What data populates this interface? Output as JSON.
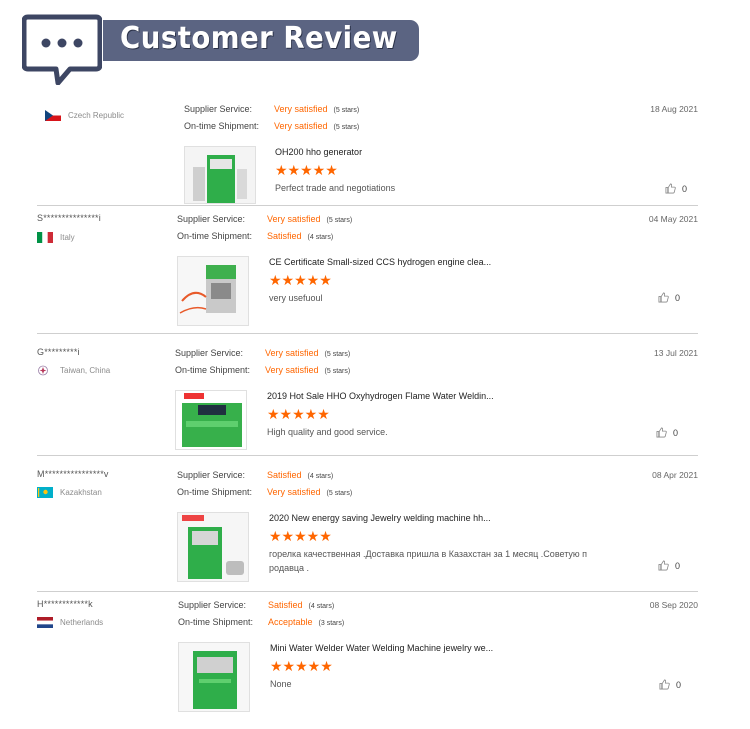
{
  "header": {
    "title": "Customer Review",
    "accent": "#5b6482"
  },
  "labels": {
    "supplier_service": "Supplier Service:",
    "ontime_shipment": "On-time Shipment:"
  },
  "reviews": [
    {
      "buyer": "",
      "country": "Czech Republic",
      "flag_icon": "czech-flag-icon",
      "date": "18 Aug 2021",
      "supplier_service": "Very satisfied",
      "supplier_stars": "(5 stars)",
      "shipment": "Very satisfied",
      "shipment_stars": "(5 stars)",
      "product": "OH200 hho generator",
      "rating": "★★★★★",
      "comment": "Perfect trade and negotiations",
      "likes": "0"
    },
    {
      "buyer": "S***************i",
      "country": "Italy",
      "flag_icon": "italy-flag-icon",
      "date": "04 May 2021",
      "supplier_service": "Very satisfied",
      "supplier_stars": "(5 stars)",
      "shipment": "Satisfied",
      "shipment_stars": "(4 stars)",
      "product": "CE Certificate Small-sized CCS hydrogen engine clea...",
      "rating": "★★★★★",
      "comment": "very usefuoul",
      "likes": "0"
    },
    {
      "buyer": "G*********i",
      "country": "Taiwan, China",
      "flag_icon": "taiwan-flag-icon",
      "date": "13 Jul 2021",
      "supplier_service": "Very satisfied",
      "supplier_stars": "(5 stars)",
      "shipment": "Very satisfied",
      "shipment_stars": "(5 stars)",
      "product": "2019 Hot Sale HHO Oxyhydrogen Flame Water Weldin...",
      "rating": "★★★★★",
      "comment": "High quality and good service.",
      "likes": "0"
    },
    {
      "buyer": "M****************v",
      "country": "Kazakhstan",
      "flag_icon": "kazakhstan-flag-icon",
      "date": "08 Apr 2021",
      "supplier_service": "Satisfied",
      "supplier_stars": "(4 stars)",
      "shipment": "Very satisfied",
      "shipment_stars": "(5 stars)",
      "product": "2020 New energy saving Jewelry welding machine hh...",
      "rating": "★★★★★",
      "comment": "горелка качественная .Доставка пришла в Казахстан за 1 месяц .Советую п родавца .",
      "likes": "0"
    },
    {
      "buyer": "H************k",
      "country": "Netherlands",
      "flag_icon": "netherlands-flag-icon",
      "date": "08 Sep 2020",
      "supplier_service": "Satisfied",
      "supplier_stars": "(4 stars)",
      "shipment": "Acceptable",
      "shipment_stars": "(3 stars)",
      "product": "Mini Water Welder Water Welding Machine jewelry we...",
      "rating": "★★★★★",
      "comment": "None",
      "likes": "0"
    }
  ]
}
